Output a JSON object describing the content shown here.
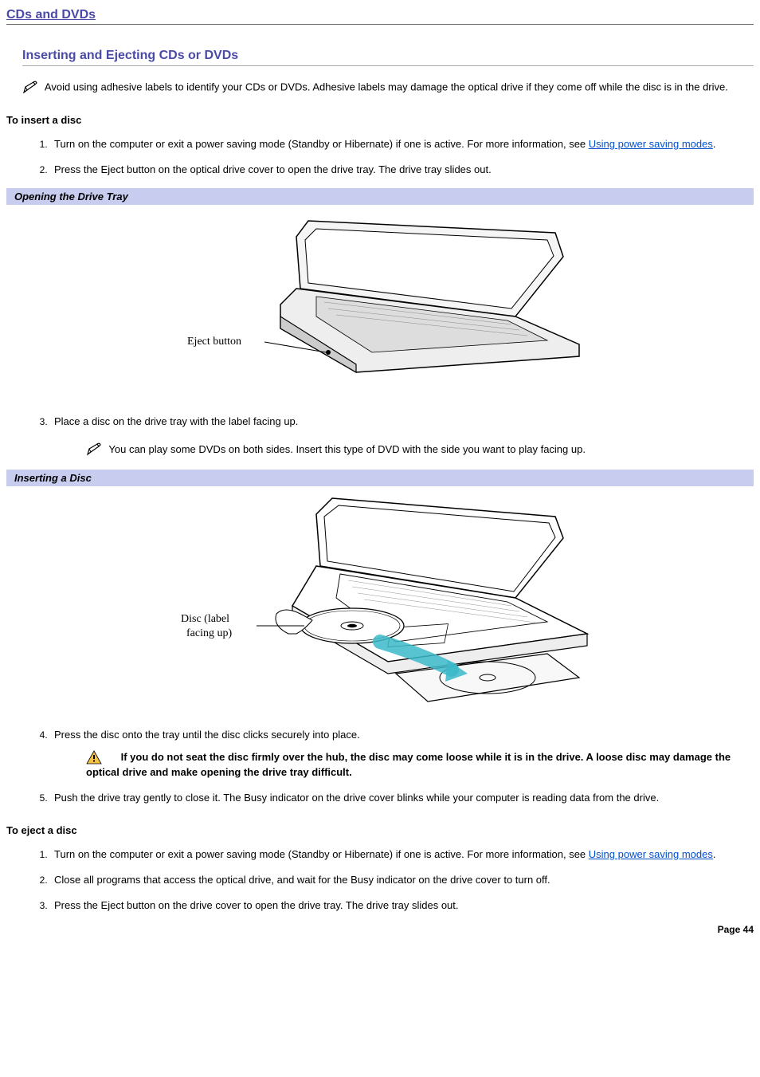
{
  "breadcrumb": "CDs and DVDs",
  "section_title": "Inserting and Ejecting CDs or DVDs",
  "intro_note": "Avoid using adhesive labels to identify your CDs or DVDs. Adhesive labels may damage the optical drive if they come off while the disc is in the drive.",
  "insert": {
    "heading": "To insert a disc",
    "steps": {
      "s1_a": "Turn on the computer or exit a power saving mode (Standby or Hibernate) if one is active. For more information, see ",
      "s1_link": "Using power saving modes",
      "s1_c": ".",
      "s2": "Press the Eject button on the optical drive cover to open the drive tray. The drive tray slides out.",
      "s3": "Place a disc on the drive tray with the label facing up.",
      "s3_note": "You can play some DVDs on both sides. Insert this type of DVD with the side you want to play facing up.",
      "s4": "Press the disc onto the tray until the disc clicks securely into place.",
      "s4_warn": "If you do not seat the disc firmly over the hub, the disc may come loose while it is in the drive. A loose disc may damage the optical drive and make opening the drive tray difficult.",
      "s5": "Push the drive tray gently to close it. The Busy indicator on the drive cover blinks while your computer is reading data from the drive."
    }
  },
  "fig1": {
    "caption": "Opening the Drive Tray",
    "label": "Eject button"
  },
  "fig2": {
    "caption": "Inserting a Disc",
    "label1": "Disc (label",
    "label2": "facing up)"
  },
  "eject": {
    "heading": "To eject a disc",
    "steps": {
      "s1_a": "Turn on the computer or exit a power saving mode (Standby or Hibernate) if one is active. For more information, see ",
      "s1_link": "Using power saving modes",
      "s1_c": ".",
      "s2": "Close all programs that access the optical drive, and wait for the Busy indicator on the drive cover to turn off.",
      "s3": "Press the Eject button on the drive cover to open the drive tray. The drive tray slides out."
    }
  },
  "page_num": "Page 44"
}
